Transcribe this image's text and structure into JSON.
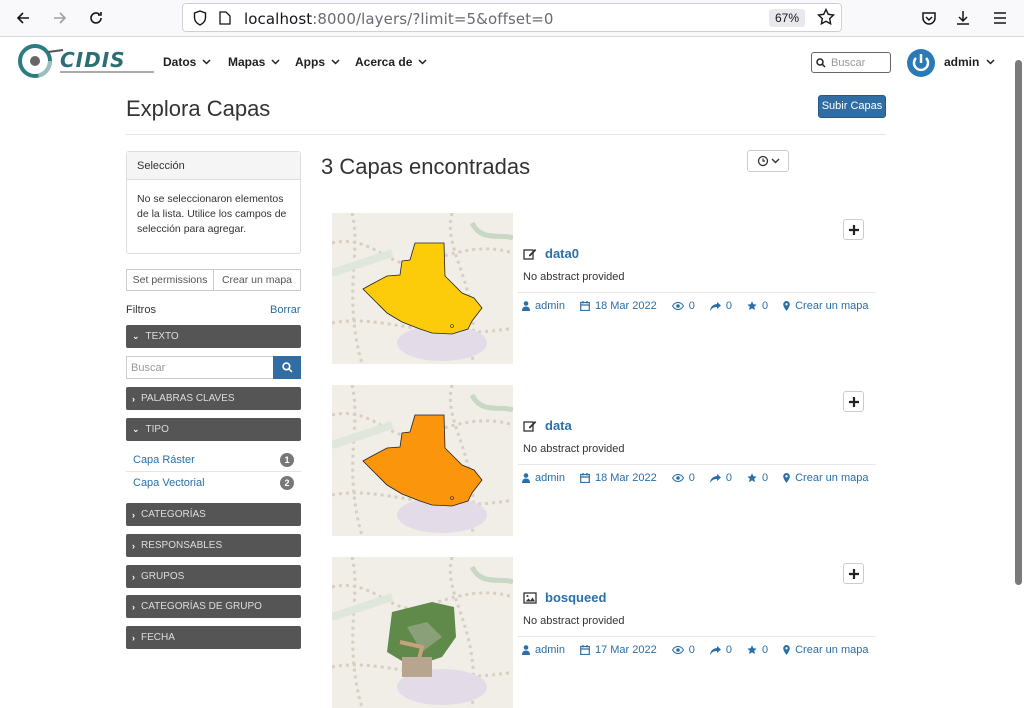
{
  "browser": {
    "url_host": "localhost",
    "url_rest": ":8000/layers/?limit=5&offset=0",
    "zoom": "67%"
  },
  "header": {
    "menu": [
      "Datos",
      "Mapas",
      "Apps",
      "Acerca de"
    ],
    "search_placeholder": "Buscar",
    "user": "admin"
  },
  "page": {
    "title": "Explora Capas",
    "upload_label": "Subir Capas"
  },
  "sidebar": {
    "selection_title": "Selección",
    "selection_body": "No se seleccionaron elementos de la lista. Utilice los campos de selección para agregar.",
    "set_permissions": "Set permissions",
    "create_map": "Crear un mapa",
    "filters_label": "Filtros",
    "clear_label": "Borrar",
    "text_filter": "TEXTO",
    "search_placeholder": "Buscar",
    "keywords_filter": "PALABRAS CLAVES",
    "type_filter": "TIPO",
    "types": [
      {
        "label": "Capa Ráster",
        "count": "1"
      },
      {
        "label": "Capa Vectorial",
        "count": "2"
      }
    ],
    "categories_filter": "CATEGORÍAS",
    "owners_filter": "RESPONSABLES",
    "groups_filter": "GRUPOS",
    "group_categories_filter": "CATEGORÍAS DE GRUPO",
    "date_filter": "FECHA"
  },
  "results": {
    "title": "3 Capas encontradas",
    "items": [
      {
        "title": "data0",
        "abstract": "No abstract provided",
        "owner": "admin",
        "date": "18 Mar 2022",
        "views": "0",
        "shares": "0",
        "rating": "0",
        "create_map": "Crear un mapa",
        "kind": "vector",
        "fill": "#fccc0b"
      },
      {
        "title": "data",
        "abstract": "No abstract provided",
        "owner": "admin",
        "date": "18 Mar 2022",
        "views": "0",
        "shares": "0",
        "rating": "0",
        "create_map": "Crear un mapa",
        "kind": "vector",
        "fill": "#fb960c"
      },
      {
        "title": "bosqueed",
        "abstract": "No abstract provided",
        "owner": "admin",
        "date": "17 Mar 2022",
        "views": "0",
        "shares": "0",
        "rating": "0",
        "create_map": "Crear un mapa",
        "kind": "raster",
        "fill": "#5f8a4a"
      }
    ]
  }
}
